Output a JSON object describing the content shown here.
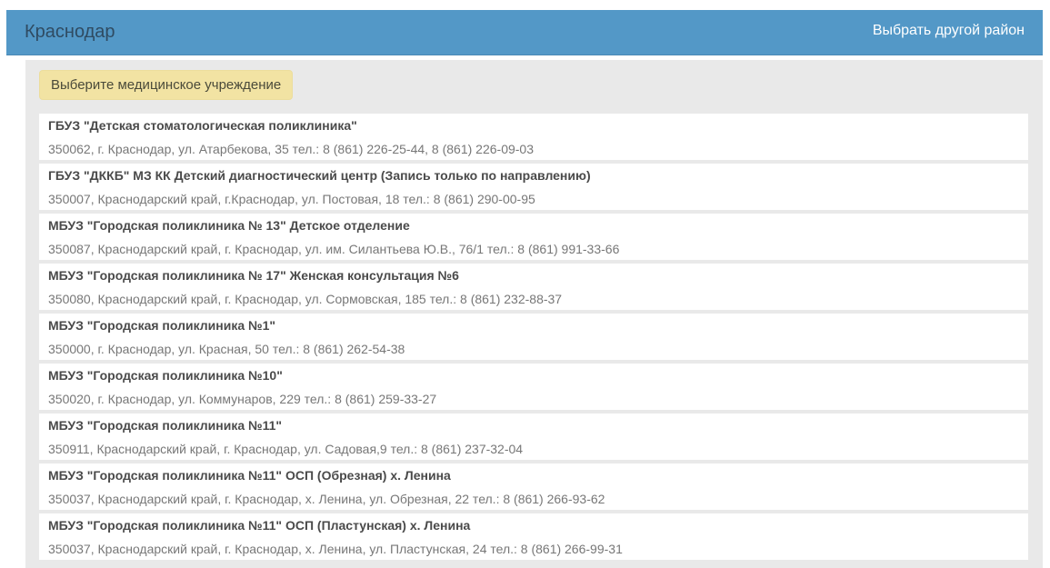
{
  "header": {
    "title": "Краснодар",
    "change_district_link": "Выбрать другой район"
  },
  "hint": {
    "text": "Выберите медицинское учреждение"
  },
  "institutions": [
    {
      "name": "ГБУЗ \"Детская стоматологическая поликлиника\"",
      "address": "350062, г. Краснодар, ул. Атарбекова, 35 тел.: 8 (861) 226-25-44, 8 (861) 226-09-03"
    },
    {
      "name": "ГБУЗ \"ДККБ\" МЗ КК Детский диагностический центр (Запись только по направлению)",
      "address": "350007, Краснодарский край, г.Краснодар, ул. Постовая, 18 тел.: 8 (861) 290-00-95"
    },
    {
      "name": "МБУЗ \"Городская поликлиника № 13\" Детское отделение",
      "address": "350087, Краснодарский край, г. Краснодар, ул. им. Силантьева Ю.В., 76/1 тел.: 8 (861) 991-33-66"
    },
    {
      "name": "МБУЗ \"Городская поликлиника № 17\" Женская консультация №6",
      "address": "350080, Краснодарский край, г. Краснодар, ул. Сормовская, 185 тел.: 8 (861) 232-88-37"
    },
    {
      "name": "МБУЗ \"Городская поликлиника №1\"",
      "address": "350000, г. Краснодар, ул. Красная, 50 тел.: 8 (861) 262-54-38"
    },
    {
      "name": "МБУЗ \"Городская поликлиника №10\"",
      "address": "350020, г. Краснодар, ул. Коммунаров, 229 тел.: 8 (861) 259-33-27"
    },
    {
      "name": "МБУЗ \"Городская поликлиника №11\"",
      "address": "350911, Краснодарский край, г. Краснодар, ул. Садовая,9 тел.: 8 (861) 237-32-04"
    },
    {
      "name": "МБУЗ \"Городская поликлиника №11\" ОСП (Обрезная) х. Ленина",
      "address": "350037, Краснодарский край, г. Краснодар, х. Ленина, ул. Обрезная, 22 тел.: 8 (861) 266-93-62"
    },
    {
      "name": "МБУЗ \"Городская поликлиника №11\" ОСП (Пластунская) х. Ленина",
      "address": "350037, Краснодарский край, г. Краснодар, х. Ленина, ул. Пластунская, 24 тел.: 8 (861) 266-99-31"
    }
  ]
}
